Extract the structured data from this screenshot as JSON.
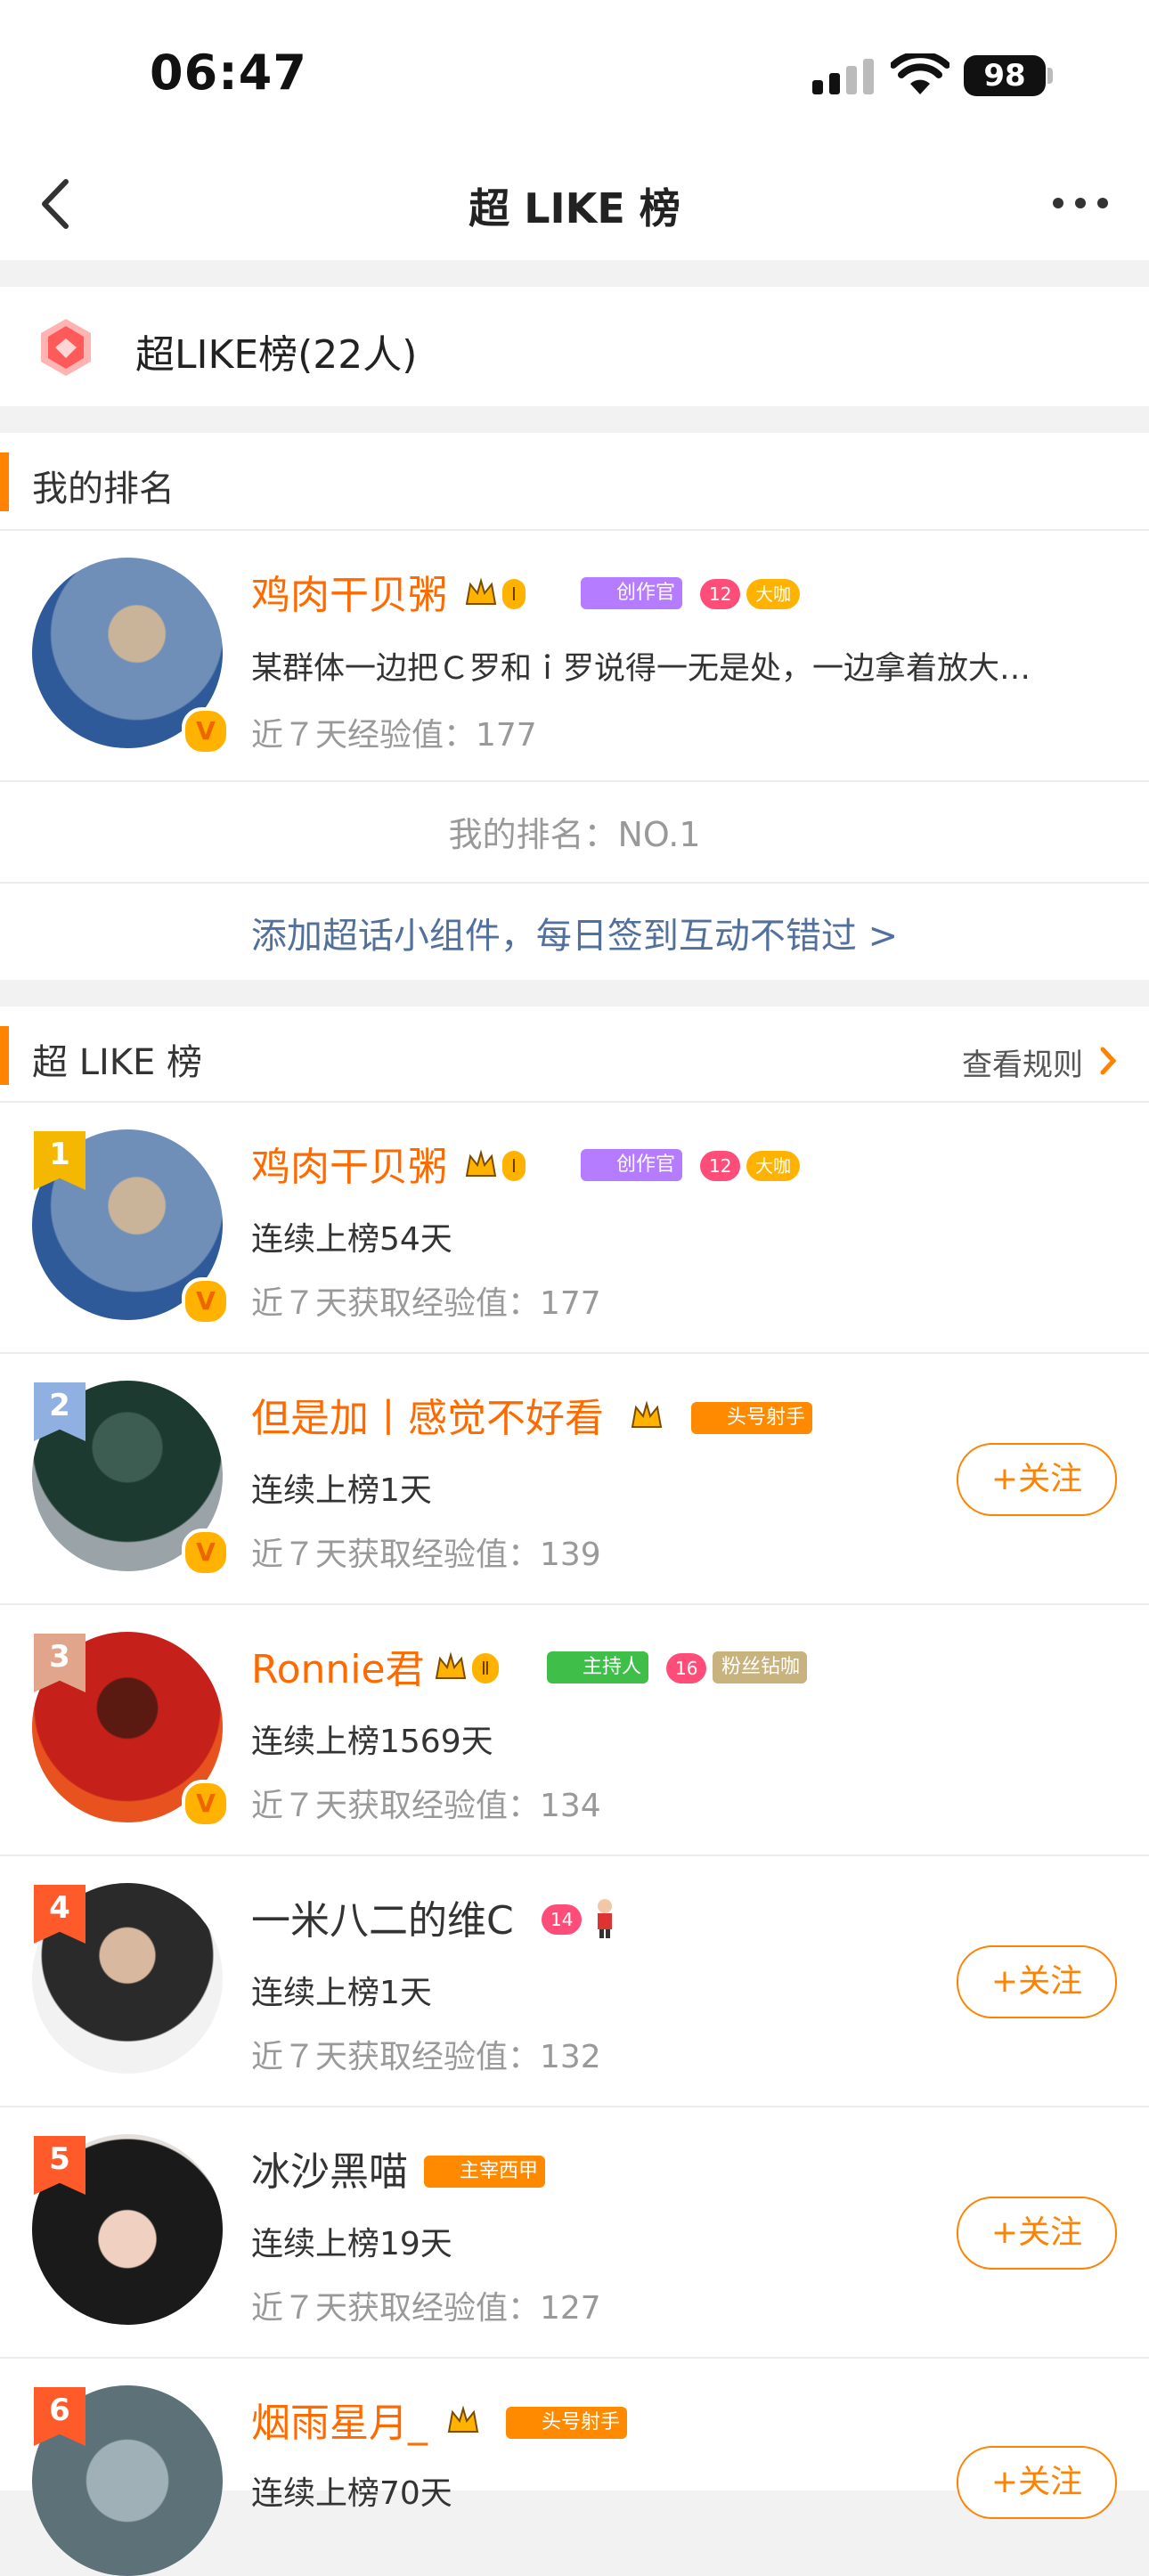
{
  "status": {
    "time": "06:47",
    "battery": "98"
  },
  "nav": {
    "title": "超 LIKE 榜"
  },
  "summary": {
    "label": "超LIKE榜(22人)"
  },
  "my_rank": {
    "section_title": "我的排名",
    "user": {
      "name": "鸡肉干贝粥",
      "post": "某群体一边把Ｃ罗和ｉ罗说得一无是处，一边拿着放大…",
      "exp": "近７天经验值：177"
    },
    "rank_text": "我的排名：NO.1",
    "widget_link": "添加超话小组件，每日签到互动不错过 >"
  },
  "leaderboard": {
    "title": "超 LIKE 榜",
    "rules_label": "查看规则",
    "follow_label": "+关注",
    "badges": {
      "creator": "创作官",
      "big": "大咖",
      "host": "主持人",
      "fan_diamond": "粉丝钻咖",
      "shooter": "头号射手",
      "zaixiang": "主宰西甲"
    },
    "items": [
      {
        "rank": "1",
        "name": "鸡肉干贝粥",
        "streak": "连续上榜54天",
        "exp": "近７天获取经验值：177"
      },
      {
        "rank": "2",
        "name": "但是加丨感觉不好看",
        "streak": "连续上榜1天",
        "exp": "近７天获取经验值：139"
      },
      {
        "rank": "3",
        "name": "Ronnie君",
        "streak": "连续上榜1569天",
        "exp": "近７天获取经验值：134"
      },
      {
        "rank": "4",
        "name": "一米八二的维C",
        "streak": "连续上榜1天",
        "exp": "近７天获取经验值：132"
      },
      {
        "rank": "5",
        "name": "冰沙黑喵",
        "streak": "连续上榜19天",
        "exp": "近７天获取经验值：127"
      },
      {
        "rank": "6",
        "name": "烟雨星月_",
        "streak": "连续上榜70天",
        "exp": ""
      }
    ]
  }
}
